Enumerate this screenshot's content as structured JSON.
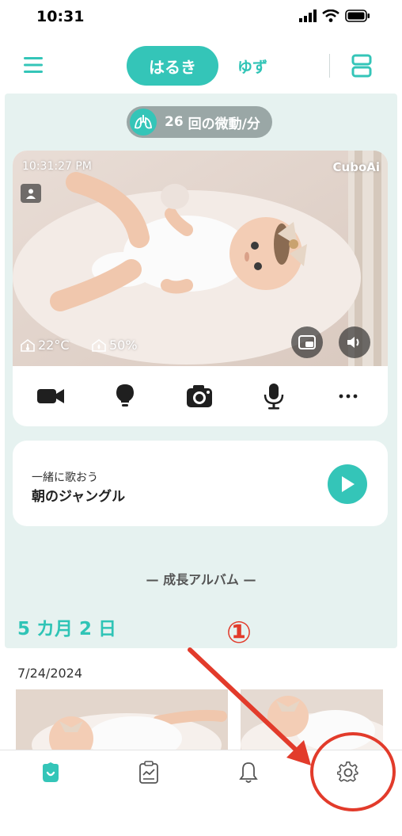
{
  "status_bar": {
    "time": "10:31"
  },
  "header": {
    "tabs": [
      {
        "label": "はるき",
        "active": true
      },
      {
        "label": "ゆず",
        "active": false
      }
    ]
  },
  "breathing": {
    "count": "26",
    "unit": "回の微動/分"
  },
  "camera": {
    "timestamp": "10:31:27 PM",
    "brand": "CuboAi",
    "temperature": "22°C",
    "humidity": "50%",
    "controls": [
      "record-icon",
      "light-icon",
      "snapshot-icon",
      "microphone-icon",
      "more-icon"
    ]
  },
  "song": {
    "subtitle": "一緒に歌おう",
    "title": "朝のジャングル"
  },
  "album": {
    "heading": "— 成長アルバム —",
    "age": "5 カ月 2 日",
    "date": "7/24/2024"
  },
  "annotation": {
    "marker": "①",
    "color": "#e23b2b"
  },
  "bottom_nav": {
    "items": [
      "home-icon",
      "report-icon",
      "notification-icon",
      "settings-icon"
    ]
  },
  "colors": {
    "accent": "#34c5b8",
    "panel_bg": "#e6f2f0",
    "annotation": "#e23b2b"
  }
}
